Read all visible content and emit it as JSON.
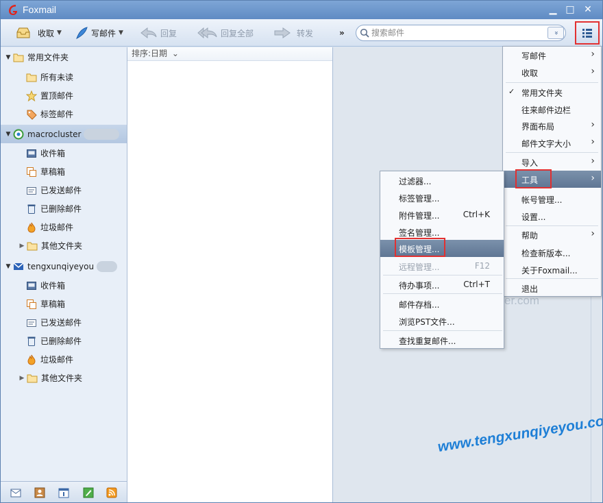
{
  "window": {
    "title": "Foxmail",
    "minimize": "▁",
    "maximize": "□",
    "close": "✕"
  },
  "toolbar": {
    "receive": "收取",
    "compose": "写邮件",
    "reply": "回复",
    "reply_all": "回复全部",
    "forward": "转发",
    "more": "»",
    "search_placeholder": "搜索邮件",
    "search_dropdown": "»"
  },
  "folders": {
    "common_title": "常用文件夹",
    "common_items": [
      "所有未读",
      "置顶邮件",
      "标签邮件"
    ],
    "account1": {
      "name": "macrocluster",
      "items": [
        "收件箱",
        "草稿箱",
        "已发送邮件",
        "已删除邮件",
        "垃圾邮件",
        "其他文件夹"
      ]
    },
    "account2": {
      "name": "tengxunqiyeyou",
      "items": [
        "收件箱",
        "草稿箱",
        "已发送邮件",
        "已删除邮件",
        "垃圾邮件",
        "其他文件夹"
      ]
    }
  },
  "mail_list": {
    "sort_label": "排序:日期",
    "sort_caret": "⌄"
  },
  "main_menu": {
    "items": [
      {
        "label": "写邮件",
        "submenu": true
      },
      {
        "label": "收取",
        "submenu": true
      },
      {
        "label": "常用文件夹",
        "checked": true
      },
      {
        "label": "往来邮件边栏"
      },
      {
        "label": "界面布局",
        "submenu": true
      },
      {
        "label": "邮件文字大小",
        "submenu": true
      },
      {
        "label": "导入",
        "submenu": true
      },
      {
        "label": "工具",
        "submenu": true,
        "highlighted": true
      },
      {
        "label": "帐号管理..."
      },
      {
        "label": "设置..."
      },
      {
        "label": "帮助",
        "submenu": true
      },
      {
        "label": "检查新版本..."
      },
      {
        "label": "关于Foxmail..."
      },
      {
        "label": "退出"
      }
    ],
    "check_mark": "✓",
    "chevron": "›"
  },
  "tools_menu": {
    "items": [
      {
        "label": "过滤器..."
      },
      {
        "label": "标签管理..."
      },
      {
        "label": "附件管理...",
        "shortcut": "Ctrl+K"
      },
      {
        "label": "签名管理..."
      },
      {
        "label": "模板管理...",
        "highlighted": true
      },
      {
        "label": "远程管理...",
        "shortcut": "F12",
        "disabled": true
      },
      {
        "label": "待办事项...",
        "shortcut": "Ctrl+T"
      },
      {
        "label": "邮件存档..."
      },
      {
        "label": "浏览PST文件..."
      },
      {
        "label": "查找重复邮件..."
      }
    ]
  },
  "reading_pane": {
    "ghost_text": "er.com"
  },
  "watermark": "www.tengxunqiyeyou.com",
  "colors": {
    "accent": "#5f8bc3",
    "highlight": "#6a819e",
    "annotation_red": "#e23030",
    "watermark_blue": "#1e7fd6"
  }
}
